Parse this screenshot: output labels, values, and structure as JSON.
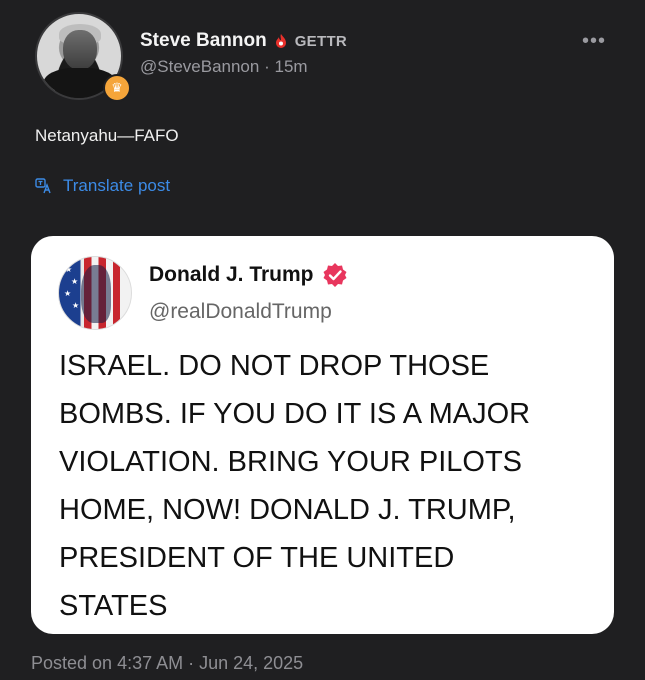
{
  "author": {
    "display_name": "Steve Bannon",
    "platform_label": "GETTR",
    "handle": "@SteveBannon",
    "separator": "·",
    "time_ago": "15m"
  },
  "post": {
    "text": "Netanyahu—FAFO",
    "translate_label": "Translate post"
  },
  "quote": {
    "display_name": "Donald J. Trump",
    "handle": "@realDonaldTrump",
    "body": "ISRAEL. DO NOT DROP THOSE\nBOMBS. IF YOU DO IT IS A MAJOR\nVIOLATION. BRING YOUR PILOTS\nHOME, NOW!  DONALD J. TRUMP,\nPRESIDENT OF THE UNITED\nSTATES"
  },
  "footer": {
    "posted_on": "Posted on 4:37 AM · Jun 24, 2025"
  },
  "icons": {
    "more": "more-horizontal-icon",
    "crown_badge": "crown-icon",
    "gettr": "gettr-flame-icon",
    "translate": "translate-icon",
    "verified": "verified-badge-icon"
  },
  "colors": {
    "background": "#1f1f21",
    "link": "#3c8be6",
    "gettr_red": "#e8302b",
    "verified_pink": "#e8365d",
    "crown_orange": "#f5a53a"
  }
}
